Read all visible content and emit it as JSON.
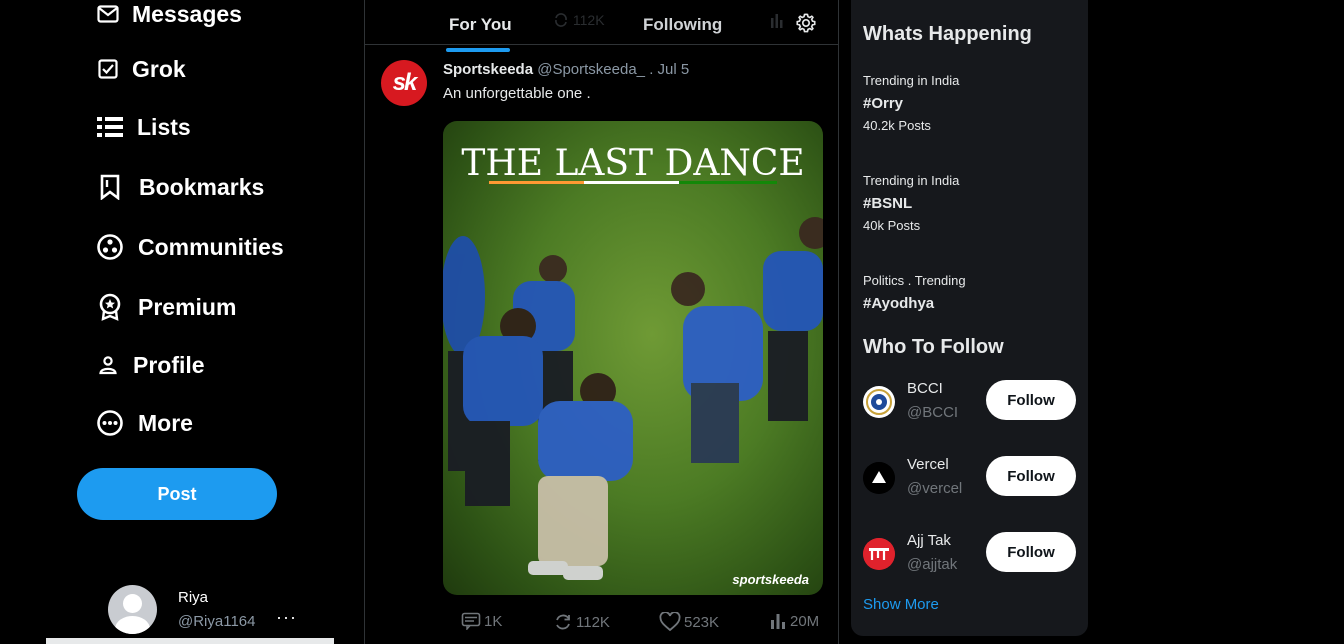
{
  "sidebar": {
    "items": [
      {
        "label": "Messages",
        "icon": "envelope-icon"
      },
      {
        "label": "Grok",
        "icon": "grok-icon"
      },
      {
        "label": "Lists",
        "icon": "list-icon"
      },
      {
        "label": "Bookmarks",
        "icon": "bookmark-icon"
      },
      {
        "label": "Communities",
        "icon": "communities-icon"
      },
      {
        "label": "Premium",
        "icon": "premium-icon"
      },
      {
        "label": "Profile",
        "icon": "person-icon"
      },
      {
        "label": "More",
        "icon": "more-circle-icon"
      }
    ],
    "post_label": "Post",
    "profile": {
      "name": "Riya",
      "handle": "@Riya1164",
      "menu": "···"
    }
  },
  "feed": {
    "tabs": [
      {
        "label": "For You",
        "active": true
      },
      {
        "label": "Following",
        "active": false
      }
    ],
    "ghost_views_count": "112K",
    "tweet": {
      "avatar_text": "sk",
      "name": "Sportskeeda",
      "handle": "@Sportskeeda_",
      "date": ". Jul 5",
      "text": "An unforgettable one .",
      "media": {
        "title": "THE LAST DANCE",
        "watermark": "sportskeeda"
      },
      "stats": {
        "replies": "1K",
        "reposts": "112K",
        "likes": "523K",
        "views": "20M"
      }
    }
  },
  "right": {
    "whats_happening_title": "Whats Happening",
    "trends": [
      {
        "category": "Trending in India",
        "tag": "#Orry",
        "count": "40.2k Posts"
      },
      {
        "category": "Trending in India",
        "tag": "#BSNL",
        "count": "40k Posts"
      },
      {
        "category": "Politics . Trending",
        "tag": "#Ayodhya",
        "count": ""
      }
    ],
    "who_to_follow_title": "Who To Follow",
    "who_to_follow": [
      {
        "name": "BCCI",
        "handle": "@BCCI",
        "button": "Follow"
      },
      {
        "name": "Vercel",
        "handle": "@vercel",
        "button": "Follow"
      },
      {
        "name": "Ajj Tak",
        "handle": "@ajjtak",
        "button": "Follow"
      }
    ],
    "show_more": "Show More"
  },
  "colors": {
    "accent": "#1d9bf0",
    "background": "#000000",
    "panel": "#16181c",
    "muted": "#71767b"
  }
}
